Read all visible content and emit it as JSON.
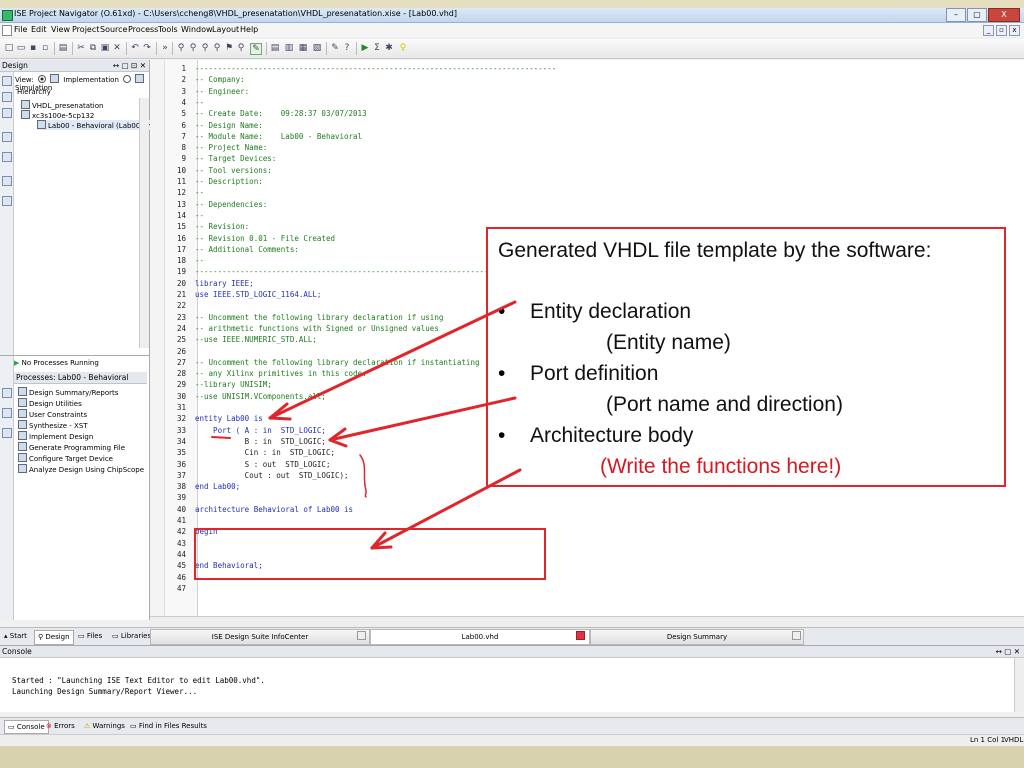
{
  "window": {
    "title": "ISE Project Navigator (O.61xd) - C:\\Users\\ccheng8\\VHDL_presenatation\\VHDL_presenatation.xise - [Lab00.vhd]",
    "controls": {
      "minimize": "–",
      "maximize": "▢",
      "close": "X"
    },
    "mdi_controls": {
      "minimize": "_",
      "restore": "▫",
      "close": "x"
    }
  },
  "menu": {
    "items": [
      "File",
      "Edit",
      "View",
      "Project",
      "Source",
      "Process",
      "Tools",
      "Window",
      "Layout",
      "Help"
    ]
  },
  "design_panel": {
    "title": "Design",
    "controls": "↔ ▢ ⊡ ✕",
    "view_label": "View:",
    "implementation_label": "Implementation",
    "simulation_label": "Simulation",
    "hierarchy_label": "Hierarchy",
    "tree": {
      "project": "VHDL_presenatation",
      "device": "xc3s100e-5cp132",
      "module": "Lab00 - Behavioral (Lab00.vhd)"
    },
    "no_processes": "No Processes Running",
    "processes_label": "Processes: Lab00 - Behavioral",
    "processes": [
      "Design Summary/Reports",
      "Design Utilities",
      "User Constraints",
      "Synthesize - XST",
      "Implement Design",
      "Generate Programming File",
      "Configure Target Device",
      "Analyze Design Using ChipScope"
    ]
  },
  "editor": {
    "lines": [
      {
        "n": "1",
        "t": "--------------------------------------------------------------------------------",
        "c": "com"
      },
      {
        "n": "2",
        "t": "-- Company:",
        "c": "com"
      },
      {
        "n": "3",
        "t": "-- Engineer:",
        "c": "com"
      },
      {
        "n": "4",
        "t": "--",
        "c": "com"
      },
      {
        "n": "5",
        "t": "-- Create Date:    09:28:37 03/07/2013",
        "c": "com"
      },
      {
        "n": "6",
        "t": "-- Design Name:",
        "c": "com"
      },
      {
        "n": "7",
        "t": "-- Module Name:    Lab00 - Behavioral",
        "c": "com"
      },
      {
        "n": "8",
        "t": "-- Project Name:",
        "c": "com"
      },
      {
        "n": "9",
        "t": "-- Target Devices:",
        "c": "com"
      },
      {
        "n": "10",
        "t": "-- Tool versions:",
        "c": "com"
      },
      {
        "n": "11",
        "t": "-- Description:",
        "c": "com"
      },
      {
        "n": "12",
        "t": "--",
        "c": "com"
      },
      {
        "n": "13",
        "t": "-- Dependencies:",
        "c": "com"
      },
      {
        "n": "14",
        "t": "--",
        "c": "com"
      },
      {
        "n": "15",
        "t": "-- Revision:",
        "c": "com"
      },
      {
        "n": "16",
        "t": "-- Revision 0.01 - File Created",
        "c": "com"
      },
      {
        "n": "17",
        "t": "-- Additional Comments:",
        "c": "com"
      },
      {
        "n": "18",
        "t": "--",
        "c": "com"
      },
      {
        "n": "19",
        "t": "--------------------------------------------------------------------------------",
        "c": "com"
      },
      {
        "n": "20",
        "t": "library IEEE;",
        "c": "kw"
      },
      {
        "n": "21",
        "t": "use IEEE.STD_LOGIC_1164.ALL;",
        "c": "kw"
      },
      {
        "n": "22",
        "t": "",
        "c": "tx"
      },
      {
        "n": "23",
        "t": "-- Uncomment the following library declaration if using",
        "c": "com"
      },
      {
        "n": "24",
        "t": "-- arithmetic functions with Signed or Unsigned values",
        "c": "com"
      },
      {
        "n": "25",
        "t": "--use IEEE.NUMERIC_STD.ALL;",
        "c": "com"
      },
      {
        "n": "26",
        "t": "",
        "c": "tx"
      },
      {
        "n": "27",
        "t": "-- Uncomment the following library declaration if instantiating",
        "c": "com"
      },
      {
        "n": "28",
        "t": "-- any Xilinx primitives in this code.",
        "c": "com"
      },
      {
        "n": "29",
        "t": "--library UNISIM;",
        "c": "com"
      },
      {
        "n": "30",
        "t": "--use UNISIM.VComponents.all;",
        "c": "com"
      },
      {
        "n": "31",
        "t": "",
        "c": "tx"
      },
      {
        "n": "32",
        "t": "entity Lab00 is",
        "c": "kw"
      },
      {
        "n": "33",
        "t": "    Port ( A : in  STD_LOGIC;",
        "c": "kw"
      },
      {
        "n": "34",
        "t": "           B : in  STD_LOGIC;",
        "c": "tx"
      },
      {
        "n": "35",
        "t": "           Cin : in  STD_LOGIC;",
        "c": "tx"
      },
      {
        "n": "36",
        "t": "           S : out  STD_LOGIC;",
        "c": "tx"
      },
      {
        "n": "37",
        "t": "           Cout : out  STD_LOGIC);",
        "c": "tx"
      },
      {
        "n": "38",
        "t": "end Lab00;",
        "c": "kw"
      },
      {
        "n": "39",
        "t": "",
        "c": "tx"
      },
      {
        "n": "40",
        "t": "architecture Behavioral of Lab00 is",
        "c": "kw"
      },
      {
        "n": "41",
        "t": "",
        "c": "tx"
      },
      {
        "n": "42",
        "t": "begin",
        "c": "kw"
      },
      {
        "n": "43",
        "t": "",
        "c": "tx"
      },
      {
        "n": "44",
        "t": "",
        "c": "tx"
      },
      {
        "n": "45",
        "t": "end Behavioral;",
        "c": "kw"
      },
      {
        "n": "46",
        "t": "",
        "c": "tx"
      },
      {
        "n": "47",
        "t": "",
        "c": "tx"
      }
    ]
  },
  "tabs": {
    "start": "Start",
    "design": "Design",
    "files": "Files",
    "libraries": "Libraries",
    "doc_infocenter": "ISE Design Suite InfoCenter",
    "doc_lab00": "Lab00.vhd",
    "doc_summary": "Design Summary"
  },
  "console": {
    "title": "Console",
    "controls": "↔ ▢ ✕",
    "lines": [
      "Started : \"Launching ISE Text Editor to edit Lab00.vhd\".",
      "Launching Design Summary/Report Viewer..."
    ],
    "tabs": [
      "Console",
      "Errors",
      "Warnings",
      "Find in Files Results"
    ]
  },
  "status": {
    "position": "Ln 1 Col 1",
    "language": "VHDL"
  },
  "callout": {
    "heading": "Generated VHDL file template by the software:",
    "bullet1": "Entity declaration",
    "sub1": "(Entity name)",
    "bullet2": "Port definition",
    "sub2": "(Port name and direction)",
    "bullet3": "Architecture body",
    "sub3": "(Write the functions here!)",
    "bullet_glyph": "•"
  },
  "colors": {
    "annotation_red": "#e0252b",
    "comment_green": "#1f7d1f",
    "keyword_blue": "#2030b8",
    "type_magenta": "#b8208a"
  }
}
